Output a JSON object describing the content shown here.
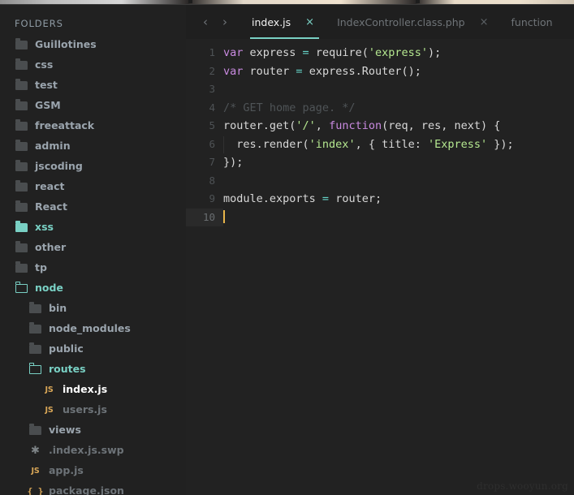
{
  "colors": {
    "accent_teal": "#79d0c4",
    "editor_bg": "#222222",
    "sidebar_bg": "#212121",
    "tabbar_bg": "#1f1f1f",
    "caret": "#e8b54a",
    "js_badge": "#d8a657",
    "string": "#b5e890",
    "keyword": "#c98ae0",
    "operator": "#65d4c8",
    "comment": "#4f5457"
  },
  "sidebar": {
    "header": "FOLDERS",
    "items": [
      {
        "label": "Guillotines",
        "icon": "folder-closed-icon",
        "indent": 0,
        "tone": "norm"
      },
      {
        "label": "css",
        "icon": "folder-closed-icon",
        "indent": 0,
        "tone": "norm"
      },
      {
        "label": "test",
        "icon": "folder-closed-icon",
        "indent": 0,
        "tone": "norm"
      },
      {
        "label": "GSM",
        "icon": "folder-closed-icon",
        "indent": 0,
        "tone": "norm"
      },
      {
        "label": "freeattack",
        "icon": "folder-closed-icon",
        "indent": 0,
        "tone": "norm"
      },
      {
        "label": "admin",
        "icon": "folder-closed-icon",
        "indent": 0,
        "tone": "norm"
      },
      {
        "label": "jscoding",
        "icon": "folder-closed-icon",
        "indent": 0,
        "tone": "norm"
      },
      {
        "label": "react",
        "icon": "folder-closed-icon",
        "indent": 0,
        "tone": "norm"
      },
      {
        "label": "React",
        "icon": "folder-closed-icon",
        "indent": 0,
        "tone": "norm"
      },
      {
        "label": "xss",
        "icon": "folder-selected-icon",
        "indent": 0,
        "tone": "teal"
      },
      {
        "label": "other",
        "icon": "folder-closed-icon",
        "indent": 0,
        "tone": "norm"
      },
      {
        "label": "tp",
        "icon": "folder-closed-icon",
        "indent": 0,
        "tone": "norm"
      },
      {
        "label": "node",
        "icon": "folder-open-icon",
        "indent": 0,
        "tone": "teal"
      },
      {
        "label": "bin",
        "icon": "folder-closed-icon",
        "indent": 1,
        "tone": "norm"
      },
      {
        "label": "node_modules",
        "icon": "folder-closed-icon",
        "indent": 1,
        "tone": "norm"
      },
      {
        "label": "public",
        "icon": "folder-closed-icon",
        "indent": 1,
        "tone": "norm"
      },
      {
        "label": "routes",
        "icon": "folder-open-icon",
        "indent": 1,
        "tone": "teal"
      },
      {
        "label": "index.js",
        "icon": "js-file-icon",
        "indent": 2,
        "tone": "bright"
      },
      {
        "label": "users.js",
        "icon": "js-file-icon",
        "indent": 2,
        "tone": "dim"
      },
      {
        "label": "views",
        "icon": "folder-closed-icon",
        "indent": 1,
        "tone": "norm"
      },
      {
        "label": ".index.js.swp",
        "icon": "swap-file-icon",
        "indent": 1,
        "tone": "dim"
      },
      {
        "label": "app.js",
        "icon": "js-file-icon",
        "indent": 1,
        "tone": "dim"
      },
      {
        "label": "package.json",
        "icon": "json-file-icon",
        "indent": 1,
        "tone": "dim"
      }
    ]
  },
  "navigation": {
    "back_icon": "chevron-left-icon",
    "back_glyph": "‹",
    "forward_icon": "chevron-right-icon",
    "forward_glyph": "›"
  },
  "tabs": [
    {
      "label": "index.js",
      "close_glyph": "×",
      "active": true
    },
    {
      "label": "IndexController.class.php",
      "close_glyph": "×",
      "active": false
    },
    {
      "label": "function",
      "close_glyph": "",
      "active": false
    }
  ],
  "code": {
    "lines": [
      {
        "n": "1",
        "tokens": [
          {
            "t": "var",
            "c": "k-kw"
          },
          {
            "t": " express ",
            "c": "k-id"
          },
          {
            "t": "=",
            "c": "k-op"
          },
          {
            "t": " require(",
            "c": "k-id"
          },
          {
            "t": "'express'",
            "c": "k-str"
          },
          {
            "t": ");",
            "c": "k-pun"
          }
        ]
      },
      {
        "n": "2",
        "tokens": [
          {
            "t": "var",
            "c": "k-kw"
          },
          {
            "t": " router ",
            "c": "k-id"
          },
          {
            "t": "=",
            "c": "k-op"
          },
          {
            "t": " express.Router();",
            "c": "k-id"
          }
        ]
      },
      {
        "n": "3",
        "tokens": []
      },
      {
        "n": "4",
        "tokens": [
          {
            "t": "/* GET home page. */",
            "c": "k-cmt"
          }
        ]
      },
      {
        "n": "5",
        "tokens": [
          {
            "t": "router.get(",
            "c": "k-id"
          },
          {
            "t": "'/'",
            "c": "k-str"
          },
          {
            "t": ", ",
            "c": "k-pun"
          },
          {
            "t": "function",
            "c": "k-kw"
          },
          {
            "t": "(req, res, next) {",
            "c": "k-id"
          }
        ]
      },
      {
        "n": "6",
        "indent": true,
        "tokens": [
          {
            "t": "  res.render(",
            "c": "k-id"
          },
          {
            "t": "'index'",
            "c": "k-str"
          },
          {
            "t": ", { title: ",
            "c": "k-id"
          },
          {
            "t": "'Express'",
            "c": "k-str"
          },
          {
            "t": " });",
            "c": "k-pun"
          }
        ]
      },
      {
        "n": "7",
        "tokens": [
          {
            "t": "});",
            "c": "k-pun"
          }
        ]
      },
      {
        "n": "8",
        "tokens": []
      },
      {
        "n": "9",
        "tokens": [
          {
            "t": "module.exports ",
            "c": "k-id"
          },
          {
            "t": "=",
            "c": "k-op"
          },
          {
            "t": " router;",
            "c": "k-id"
          }
        ]
      },
      {
        "n": "10",
        "active": true,
        "caret": true,
        "tokens": []
      }
    ]
  },
  "watermark": "drops.wooyun.org"
}
